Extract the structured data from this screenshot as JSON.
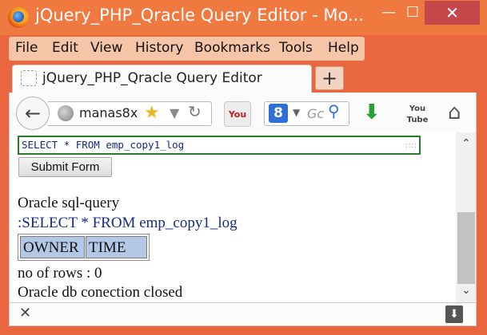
{
  "window": {
    "title": "jQuery_PHP_Qracle Query Editor - Mo...",
    "minimize_label": "—",
    "maximize_label": "☐",
    "close_label": "✕"
  },
  "menu": [
    "File",
    "Edit",
    "View",
    "History",
    "Bookmarks",
    "Tools",
    "Help"
  ],
  "tab": {
    "title": "jQuery_PHP_Qracle Query Editor",
    "new_tab_label": "+"
  },
  "toolbar": {
    "url": "manas8x",
    "search_placeholder": "Gc",
    "search_engine_letter": "8",
    "youtube_label": "You Tube",
    "youtube_label_2": "You Tube"
  },
  "form": {
    "query_value": "SELECT * FROM emp_copy1_log",
    "submit_label": "Submit Form"
  },
  "result": {
    "heading": "Oracle sql-query",
    "query_line": ":SELECT * FROM emp_copy1_log",
    "columns": [
      "OWNER",
      "TIME"
    ],
    "rows_text": "no of rows : 0",
    "status_text": "Oracle db conection closed"
  },
  "colors": {
    "titlebar": "#f0793f",
    "query_text": "#142b82",
    "table_header": "#b3c7e6",
    "textarea_border": "#2b7a2b"
  }
}
